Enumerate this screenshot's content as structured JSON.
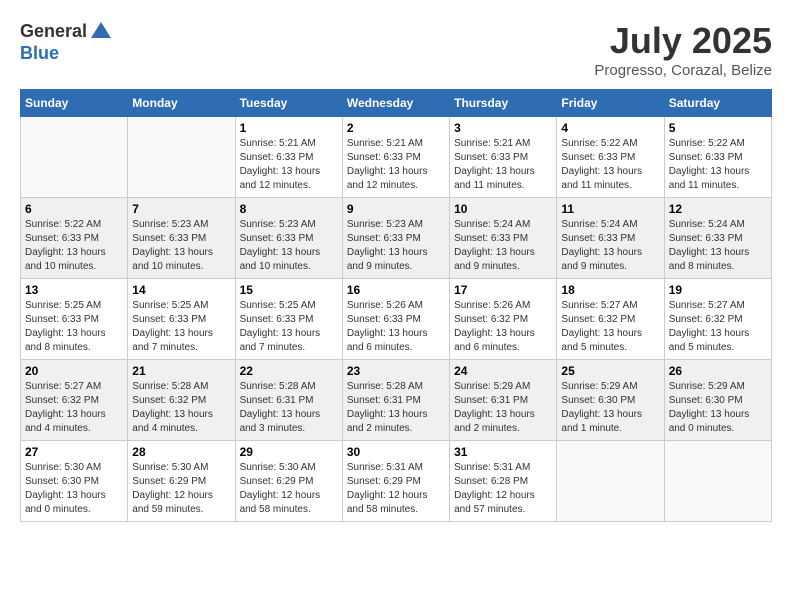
{
  "logo": {
    "general": "General",
    "blue": "Blue"
  },
  "title": {
    "month_year": "July 2025",
    "location": "Progresso, Corazal, Belize"
  },
  "days_of_week": [
    "Sunday",
    "Monday",
    "Tuesday",
    "Wednesday",
    "Thursday",
    "Friday",
    "Saturday"
  ],
  "weeks": [
    [
      {
        "day": "",
        "info": ""
      },
      {
        "day": "",
        "info": ""
      },
      {
        "day": "1",
        "info": "Sunrise: 5:21 AM\nSunset: 6:33 PM\nDaylight: 13 hours and 12 minutes."
      },
      {
        "day": "2",
        "info": "Sunrise: 5:21 AM\nSunset: 6:33 PM\nDaylight: 13 hours and 12 minutes."
      },
      {
        "day": "3",
        "info": "Sunrise: 5:21 AM\nSunset: 6:33 PM\nDaylight: 13 hours and 11 minutes."
      },
      {
        "day": "4",
        "info": "Sunrise: 5:22 AM\nSunset: 6:33 PM\nDaylight: 13 hours and 11 minutes."
      },
      {
        "day": "5",
        "info": "Sunrise: 5:22 AM\nSunset: 6:33 PM\nDaylight: 13 hours and 11 minutes."
      }
    ],
    [
      {
        "day": "6",
        "info": "Sunrise: 5:22 AM\nSunset: 6:33 PM\nDaylight: 13 hours and 10 minutes."
      },
      {
        "day": "7",
        "info": "Sunrise: 5:23 AM\nSunset: 6:33 PM\nDaylight: 13 hours and 10 minutes."
      },
      {
        "day": "8",
        "info": "Sunrise: 5:23 AM\nSunset: 6:33 PM\nDaylight: 13 hours and 10 minutes."
      },
      {
        "day": "9",
        "info": "Sunrise: 5:23 AM\nSunset: 6:33 PM\nDaylight: 13 hours and 9 minutes."
      },
      {
        "day": "10",
        "info": "Sunrise: 5:24 AM\nSunset: 6:33 PM\nDaylight: 13 hours and 9 minutes."
      },
      {
        "day": "11",
        "info": "Sunrise: 5:24 AM\nSunset: 6:33 PM\nDaylight: 13 hours and 9 minutes."
      },
      {
        "day": "12",
        "info": "Sunrise: 5:24 AM\nSunset: 6:33 PM\nDaylight: 13 hours and 8 minutes."
      }
    ],
    [
      {
        "day": "13",
        "info": "Sunrise: 5:25 AM\nSunset: 6:33 PM\nDaylight: 13 hours and 8 minutes."
      },
      {
        "day": "14",
        "info": "Sunrise: 5:25 AM\nSunset: 6:33 PM\nDaylight: 13 hours and 7 minutes."
      },
      {
        "day": "15",
        "info": "Sunrise: 5:25 AM\nSunset: 6:33 PM\nDaylight: 13 hours and 7 minutes."
      },
      {
        "day": "16",
        "info": "Sunrise: 5:26 AM\nSunset: 6:33 PM\nDaylight: 13 hours and 6 minutes."
      },
      {
        "day": "17",
        "info": "Sunrise: 5:26 AM\nSunset: 6:32 PM\nDaylight: 13 hours and 6 minutes."
      },
      {
        "day": "18",
        "info": "Sunrise: 5:27 AM\nSunset: 6:32 PM\nDaylight: 13 hours and 5 minutes."
      },
      {
        "day": "19",
        "info": "Sunrise: 5:27 AM\nSunset: 6:32 PM\nDaylight: 13 hours and 5 minutes."
      }
    ],
    [
      {
        "day": "20",
        "info": "Sunrise: 5:27 AM\nSunset: 6:32 PM\nDaylight: 13 hours and 4 minutes."
      },
      {
        "day": "21",
        "info": "Sunrise: 5:28 AM\nSunset: 6:32 PM\nDaylight: 13 hours and 4 minutes."
      },
      {
        "day": "22",
        "info": "Sunrise: 5:28 AM\nSunset: 6:31 PM\nDaylight: 13 hours and 3 minutes."
      },
      {
        "day": "23",
        "info": "Sunrise: 5:28 AM\nSunset: 6:31 PM\nDaylight: 13 hours and 2 minutes."
      },
      {
        "day": "24",
        "info": "Sunrise: 5:29 AM\nSunset: 6:31 PM\nDaylight: 13 hours and 2 minutes."
      },
      {
        "day": "25",
        "info": "Sunrise: 5:29 AM\nSunset: 6:30 PM\nDaylight: 13 hours and 1 minute."
      },
      {
        "day": "26",
        "info": "Sunrise: 5:29 AM\nSunset: 6:30 PM\nDaylight: 13 hours and 0 minutes."
      }
    ],
    [
      {
        "day": "27",
        "info": "Sunrise: 5:30 AM\nSunset: 6:30 PM\nDaylight: 13 hours and 0 minutes."
      },
      {
        "day": "28",
        "info": "Sunrise: 5:30 AM\nSunset: 6:29 PM\nDaylight: 12 hours and 59 minutes."
      },
      {
        "day": "29",
        "info": "Sunrise: 5:30 AM\nSunset: 6:29 PM\nDaylight: 12 hours and 58 minutes."
      },
      {
        "day": "30",
        "info": "Sunrise: 5:31 AM\nSunset: 6:29 PM\nDaylight: 12 hours and 58 minutes."
      },
      {
        "day": "31",
        "info": "Sunrise: 5:31 AM\nSunset: 6:28 PM\nDaylight: 12 hours and 57 minutes."
      },
      {
        "day": "",
        "info": ""
      },
      {
        "day": "",
        "info": ""
      }
    ]
  ]
}
